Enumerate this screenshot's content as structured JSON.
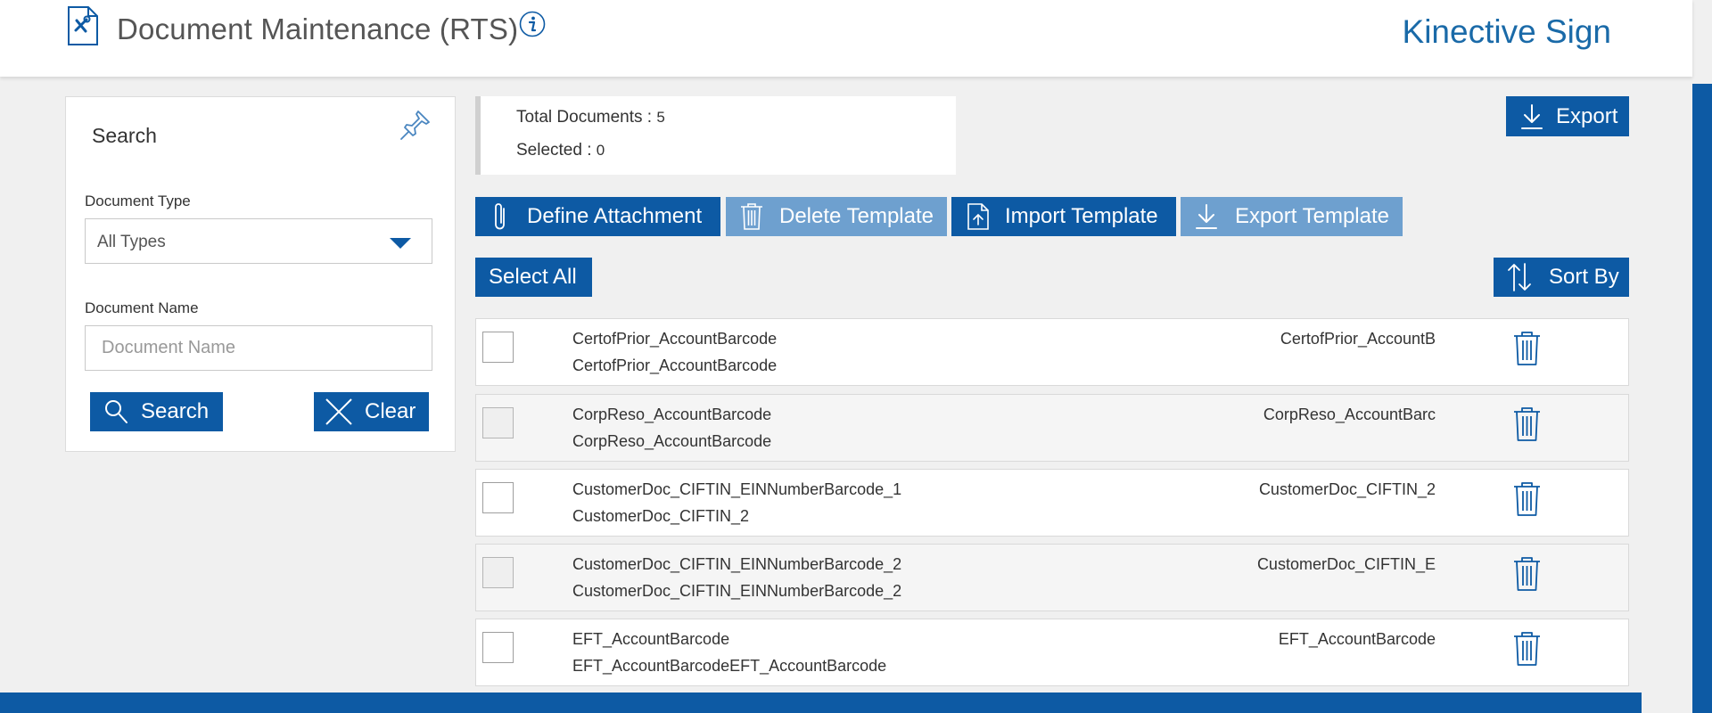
{
  "header": {
    "title": "Document Maintenance (RTS)",
    "brand": "Kinective Sign",
    "icons": {
      "page": "document-tools-icon",
      "info": "info-icon"
    }
  },
  "search": {
    "title": "Search",
    "doc_type_label": "Document Type",
    "doc_type_value": "All Types",
    "doc_name_label": "Document Name",
    "doc_name_placeholder": "Document Name",
    "doc_name_value": "",
    "search_label": "Search",
    "clear_label": "Clear"
  },
  "summary": {
    "total_label": "Total Documents : ",
    "total_value": "5",
    "selected_label": "Selected : ",
    "selected_value": "0"
  },
  "toolbar": {
    "export_label": "Export",
    "define_attachment_label": "Define Attachment",
    "delete_template_label": "Delete Template",
    "import_template_label": "Import Template",
    "export_template_label": "Export Template",
    "select_all_label": "Select All",
    "sort_by_label": "Sort By"
  },
  "colors": {
    "accent": "#0d5aa4",
    "accent_disabled": "#6ea0cf",
    "brand_text": "#1a6aa8",
    "background": "#f0f0f0"
  },
  "documents": [
    {
      "primary": "CertofPrior_AccountBarcode",
      "secondary": "CertofPrior_AccountBarcode",
      "short": "CertofPrior_AccountB",
      "checked": false
    },
    {
      "primary": "CorpReso_AccountBarcode",
      "secondary": "CorpReso_AccountBarcode",
      "short": "CorpReso_AccountBarc",
      "checked": false
    },
    {
      "primary": "CustomerDoc_CIFTIN_EINNumberBarcode_1",
      "secondary": "CustomerDoc_CIFTIN_2",
      "short": "CustomerDoc_CIFTIN_2",
      "checked": false
    },
    {
      "primary": "CustomerDoc_CIFTIN_EINNumberBarcode_2",
      "secondary": "CustomerDoc_CIFTIN_EINNumberBarcode_2",
      "short": "CustomerDoc_CIFTIN_E",
      "checked": false
    },
    {
      "primary": "EFT_AccountBarcode",
      "secondary": "EFT_AccountBarcodeEFT_AccountBarcode",
      "short": "EFT_AccountBarcode",
      "checked": false
    }
  ]
}
